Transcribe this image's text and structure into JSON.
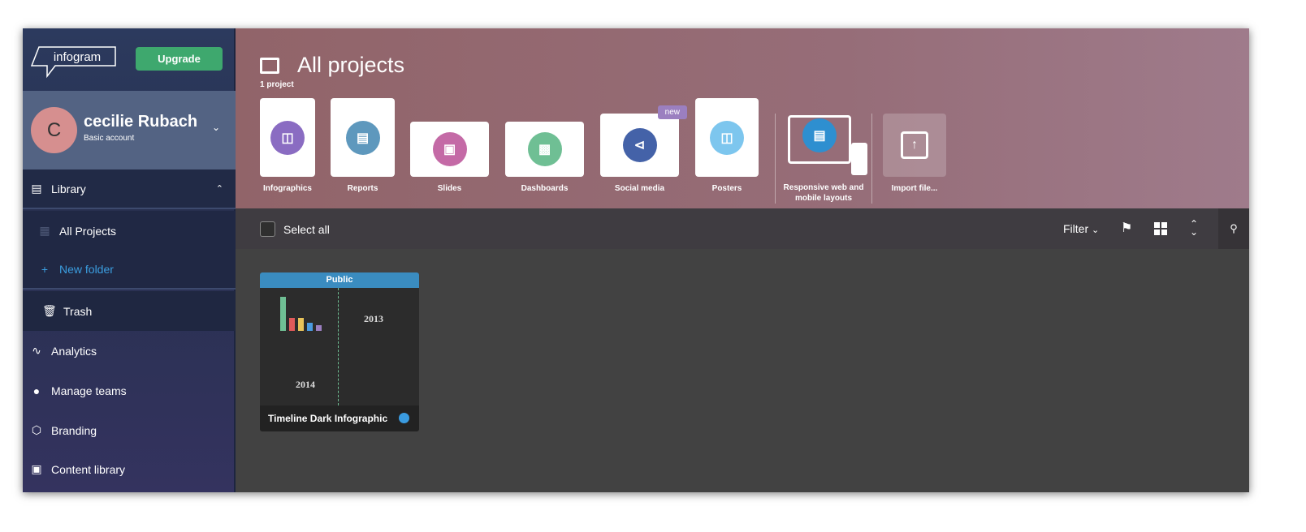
{
  "sidebar": {
    "logo": "infogram",
    "upgrade": "Upgrade",
    "user": {
      "initial": "C",
      "name": "cecilie Rubach",
      "account": "Basic account"
    },
    "library": "Library",
    "all_projects": "All Projects",
    "new_folder": "New folder",
    "trash": "Trash",
    "items": [
      {
        "label": "Analytics",
        "icon": "analytics-icon"
      },
      {
        "label": "Manage teams",
        "icon": "teams-icon"
      },
      {
        "label": "Branding",
        "icon": "cube-icon"
      },
      {
        "label": "Content library",
        "icon": "image-icon"
      }
    ]
  },
  "header": {
    "title": "All projects",
    "count": "1 project",
    "templates": [
      {
        "label": "Infographics",
        "color": "#8a6cc2"
      },
      {
        "label": "Reports",
        "color": "#5e98bd"
      },
      {
        "label": "Slides",
        "color": "#c46aa6"
      },
      {
        "label": "Dashboards",
        "color": "#6fbf94"
      },
      {
        "label": "Social media",
        "color": "#4462a8",
        "badge": "new"
      },
      {
        "label": "Posters",
        "color": "#7dc6ee"
      },
      {
        "label": "Responsive web and mobile layouts",
        "color": "#2e8fd0"
      },
      {
        "label": "Import file..."
      }
    ]
  },
  "toolbar": {
    "select_all": "Select all",
    "filter": "Filter"
  },
  "projects": [
    {
      "title": "Timeline Dark Infographic",
      "visibility": "Public",
      "years": [
        "2013",
        "2014"
      ]
    }
  ]
}
